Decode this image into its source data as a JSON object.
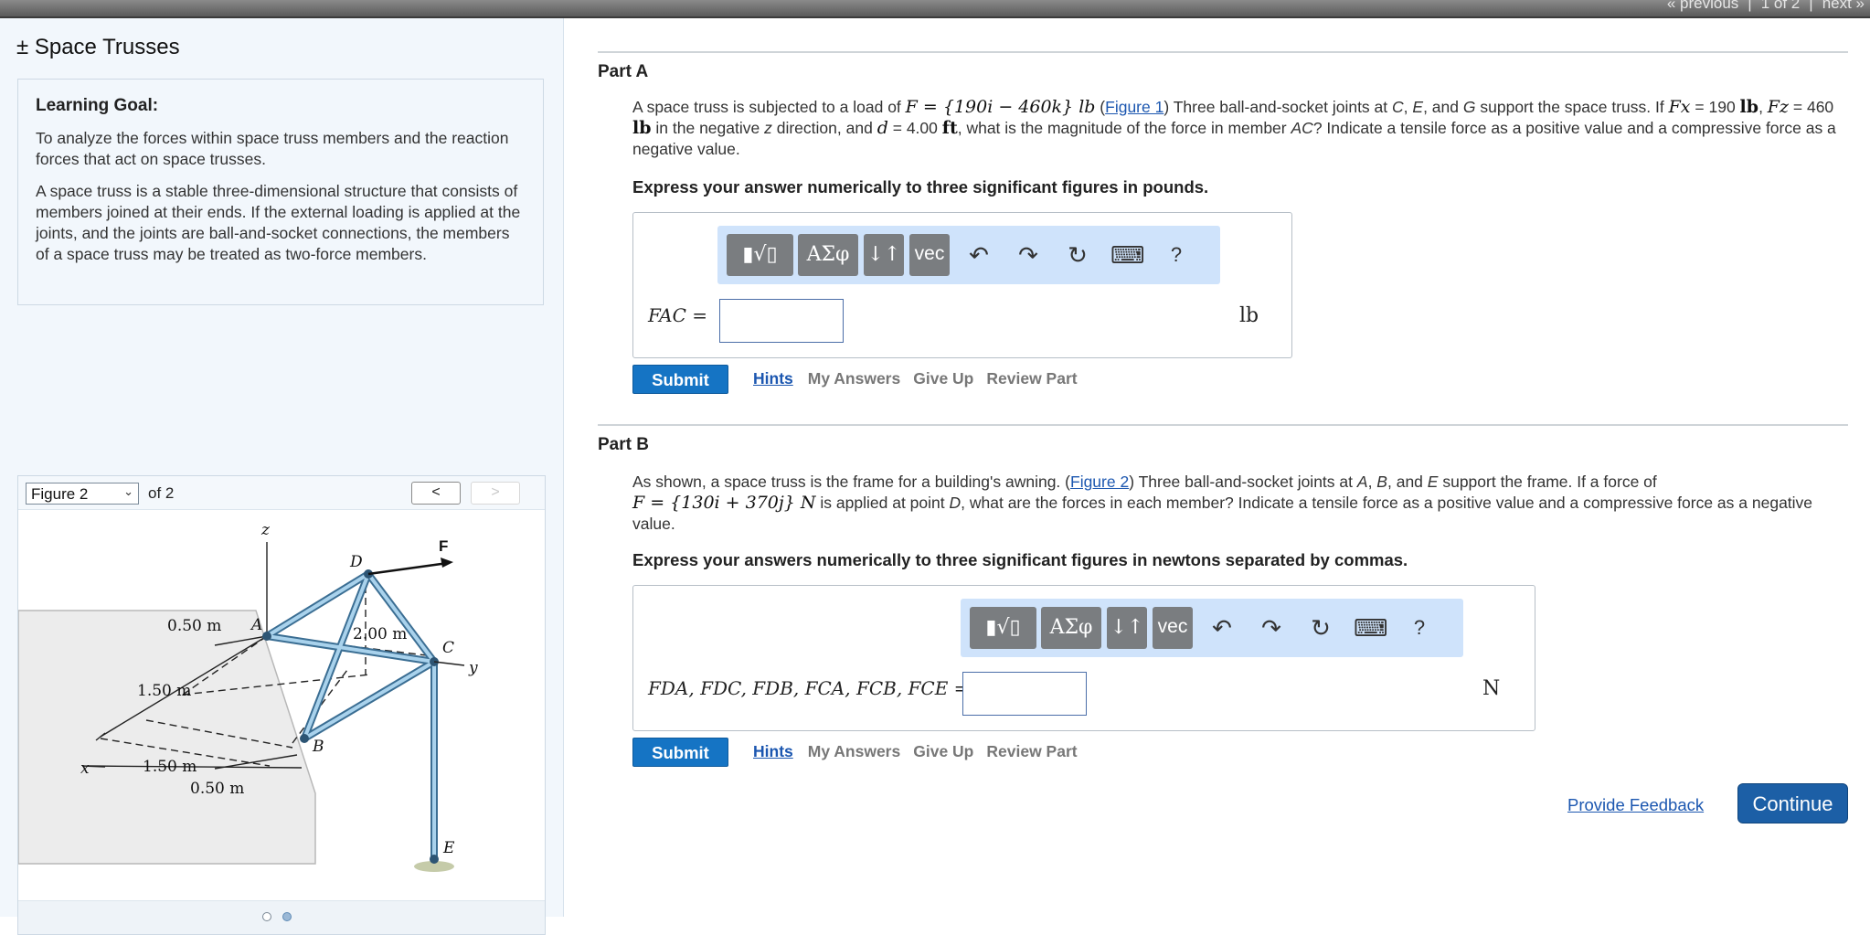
{
  "topnav": {
    "previous": "« previous",
    "page": "1 of 2",
    "next": "next »"
  },
  "sidebar": {
    "title": "± Space Trusses",
    "goal_heading": "Learning Goal:",
    "goal_p1": "To analyze the forces within space truss members and the reaction forces that act on space trusses.",
    "goal_p2": "A space truss is a stable three-dimensional structure that consists of members joined at their ends. If the external loading is applied at the joints, and the joints are ball-and-socket connections, the members of a space truss may be treated as two-force members."
  },
  "figure": {
    "selected": "Figure 2",
    "of": "of 2",
    "prev": "<",
    "next": ">",
    "labels": {
      "z": "z",
      "D": "D",
      "F": "F",
      "A": "A",
      "C": "C",
      "y": "y",
      "B": "B",
      "E": "E",
      "x": "x",
      "d050top": "0.50 m",
      "d150left": "1.50 m",
      "d200": "2.00 m",
      "d150bottom": "1.50 m",
      "d050bottom": "0.50 m"
    }
  },
  "partA": {
    "title": "Part A",
    "t1": "A space truss is subjected to a load of",
    "load": "F = {190i − 460k} lb",
    "fig_link": "Figure 1",
    "t2": "Three ball-and-socket joints at",
    "j1": "C",
    "j2": "E",
    "j3": "G",
    "t3": "support the space truss. If",
    "fx_sym": "Fx",
    "fx_val": "= 190",
    "fx_unit": "lb",
    "fz_sym": "Fz",
    "fz_val": "= 460",
    "fz_unit": "lb",
    "t4": "in the negative",
    "zdir": "z",
    "t5": "direction, and",
    "d_sym": "d",
    "d_val": "= 4.00",
    "d_unit": "ft",
    "t6": ", what is the magnitude of the force in member",
    "member": "AC",
    "t7": "? Indicate a tensile force as a positive value and a compressive force as a negative value.",
    "express": "Express your answer numerically to three significant figures in pounds.",
    "answer_label": "FAC =",
    "unit": "lb"
  },
  "partB": {
    "title": "Part B",
    "t1": "As shown, a space truss is the frame for a building's awning.",
    "fig_link": "Figure 2",
    "t2": "Three ball-and-socket joints at",
    "j1": "A",
    "j2": "B",
    "j3": "E",
    "t3": "support the frame. If a force of",
    "force": "F = {130i + 370j} N",
    "t4": "is applied at point",
    "point": "D",
    "t5": ", what are the forces in each member? Indicate a tensile force as a positive value and a compressive force as a negative value.",
    "express": "Express your answers numerically to three significant figures in newtons separated by commas.",
    "answer_label": "FDA, FDC, FDB, FCA, FCB, FCE =",
    "unit": "N"
  },
  "toolbar": {
    "templates": "▮√▯",
    "greek": "ΑΣφ",
    "arrows": "↓↑",
    "vec": "vec",
    "undo": "↶",
    "redo": "↷",
    "reset": "↻",
    "keyboard": "⌨",
    "help": "?"
  },
  "actions": {
    "submit": "Submit",
    "hints": "Hints",
    "my_answers": "My Answers",
    "give_up": "Give Up",
    "review": "Review Part"
  },
  "footer": {
    "feedback": "Provide Feedback",
    "continue": "Continue"
  }
}
